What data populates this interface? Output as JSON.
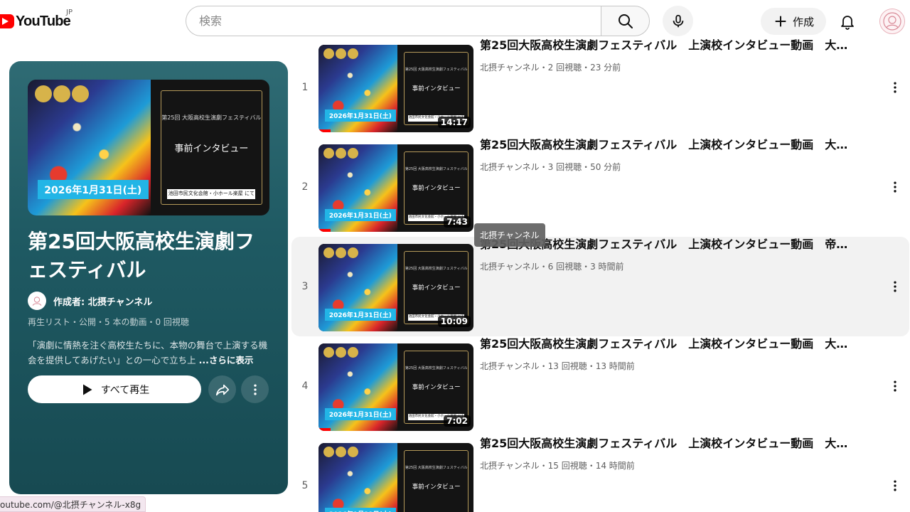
{
  "header": {
    "logo_text": "YouTube",
    "logo_region": "JP",
    "search_placeholder": "検索",
    "create_label": "作成"
  },
  "playlist": {
    "title": "第25回大阪高校生演劇フェスティバル",
    "owner": "作成者: 北摂チャンネル",
    "meta": "再生リスト・公開・5 本の動画・0 回視聴",
    "description": "「演劇に情熱を注ぐ高校生たちに、本物の舞台で上演する機会を提供してあげたい」との一心で立ち上",
    "more_label": "...さらに表示",
    "play_all_label": "すべて再生"
  },
  "thumbnail": {
    "date_text": "2026年1月31日(土)",
    "sub_text": "第25回 大阪高校生演劇フェスティバル",
    "headline": "事前インタビュー",
    "venue_text": "池田市民文化会館・小ホール楽屋 にて"
  },
  "videos": [
    {
      "index": "1",
      "title": "第25回大阪高校生演劇フェスティバル　上演校インタビュー動画　大…",
      "meta": "北摂チャンネル・2 回視聴・23 分前",
      "duration": "14:17",
      "progress": 0.08
    },
    {
      "index": "2",
      "title": "第25回大阪高校生演劇フェスティバル　上演校インタビュー動画　大…",
      "meta": "北摂チャンネル・3 回視聴・50 分前",
      "duration": "7:43",
      "progress": 0.08
    },
    {
      "index": "3",
      "title": "第25回大阪高校生演劇フェスティバル　上演校インタビュー動画　帝…",
      "meta": "北摂チャンネル・6 回視聴・3 時間前",
      "duration": "10:09",
      "progress": 0
    },
    {
      "index": "4",
      "title": "第25回大阪高校生演劇フェスティバル　上演校インタビュー動画　大…",
      "meta": "北摂チャンネル・13 回視聴・13 時間前",
      "duration": "7:02",
      "progress": 0.08
    },
    {
      "index": "5",
      "title": "第25回大阪高校生演劇フェスティバル　上演校インタビュー動画　大…",
      "meta": "北摂チャンネル・15 回視聴・14 時間前",
      "duration": "",
      "progress": 0
    }
  ],
  "tooltip": "北摂チャンネル",
  "status_url": "outube.com/@北摂チャンネル-x8g",
  "colors": {
    "brand_red": "#ff0000",
    "panel_teal": "#1f5a63",
    "hover_bg": "#f2f2f2"
  }
}
